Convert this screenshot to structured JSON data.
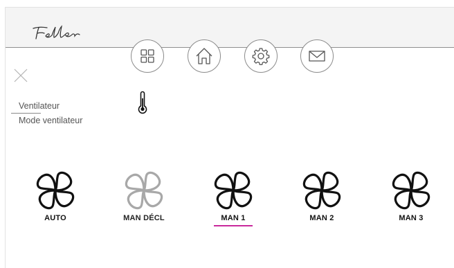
{
  "header": {
    "logo_text": "Feller",
    "nav": [
      {
        "name": "apps",
        "icon": "grid-icon"
      },
      {
        "name": "home",
        "icon": "home-icon"
      },
      {
        "name": "settings",
        "icon": "gear-icon"
      },
      {
        "name": "messages",
        "icon": "mail-icon"
      }
    ]
  },
  "breadcrumb": {
    "parent": "Ventilateur",
    "current": "Mode ventilateur"
  },
  "status_icon": "thermometer-icon",
  "modes": [
    {
      "label": "AUTO",
      "state": "enabled",
      "selected": false
    },
    {
      "label": "MAN DÉCL",
      "state": "disabled",
      "selected": false
    },
    {
      "label": "MAN 1",
      "state": "enabled",
      "selected": true
    },
    {
      "label": "MAN 2",
      "state": "enabled",
      "selected": false
    },
    {
      "label": "MAN 3",
      "state": "enabled",
      "selected": false
    }
  ],
  "colors": {
    "accent": "#c8289c",
    "icon_active": "#111111",
    "icon_disabled": "#a8a8a8",
    "header_bg": "#f4f4f4"
  }
}
